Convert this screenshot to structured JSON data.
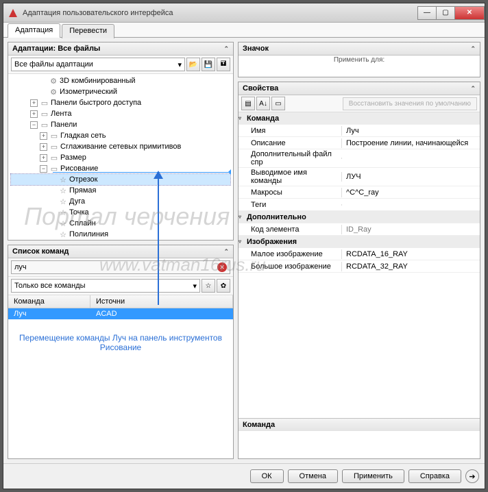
{
  "window": {
    "title": "Адаптация пользовательского интерфейса"
  },
  "tabs": {
    "adapt": "Адаптация",
    "translate": "Перевести"
  },
  "leftTop": {
    "title": "Адаптации: Все файлы",
    "select": "Все файлы адаптации",
    "tree": {
      "t3d": "3D комбинированный",
      "iso": "Изометрический",
      "quick": "Панели быстрого доступа",
      "ribbon": "Лента",
      "panels": "Панели",
      "smooth": "Гладкая сеть",
      "mesh": "Сглаживание сетевых примитивов",
      "dim": "Размер",
      "draw": "Рисование",
      "seg": "Отрезок",
      "line": "Прямая",
      "arc": "Дуга",
      "point": "Точка",
      "spline": "Сплайн",
      "pline": "Полилиния"
    }
  },
  "commands": {
    "title": "Список команд",
    "search": "луч",
    "filter": "Только все команды",
    "colCmd": "Команда",
    "colSrc": "Источни",
    "rowCmd": "Луч",
    "rowSrc": "ACAD"
  },
  "callout": "Перемещение команды Луч на панель инструментов Рисование",
  "right": {
    "iconTitle": "Значок",
    "applyTo": "Применить для:",
    "propsTitle": "Свойства",
    "restore": "Восстановить значения по умолчанию",
    "cats": {
      "cmd": "Команда",
      "extra": "Дополнительно",
      "img": "Изображения"
    },
    "props": {
      "nameK": "Имя",
      "nameV": "Луч",
      "descK": "Описание",
      "descV": "Построение линии, начинающейся",
      "addFileK": "Дополнительный файл спр",
      "addFileV": "",
      "dispNameK": "Выводимое имя команды",
      "dispNameV": "ЛУЧ",
      "macroK": "Макросы",
      "macroV": "^C^C_ray",
      "tagsK": "Теги",
      "tagsV": "",
      "elIdK": "Код элемента",
      "elIdV": "ID_Ray",
      "smallK": "Малое изображение",
      "smallV": "RCDATA_16_RAY",
      "largeK": "Большое изображение",
      "largeV": "RCDATA_32_RAY"
    },
    "helpTitle": "Команда"
  },
  "footer": {
    "ok": "ОК",
    "cancel": "Отмена",
    "apply": "Применить",
    "help": "Справка"
  },
  "watermark": {
    "l1": "Портал черчения",
    "l2": "www.vatman16rus.ru"
  }
}
